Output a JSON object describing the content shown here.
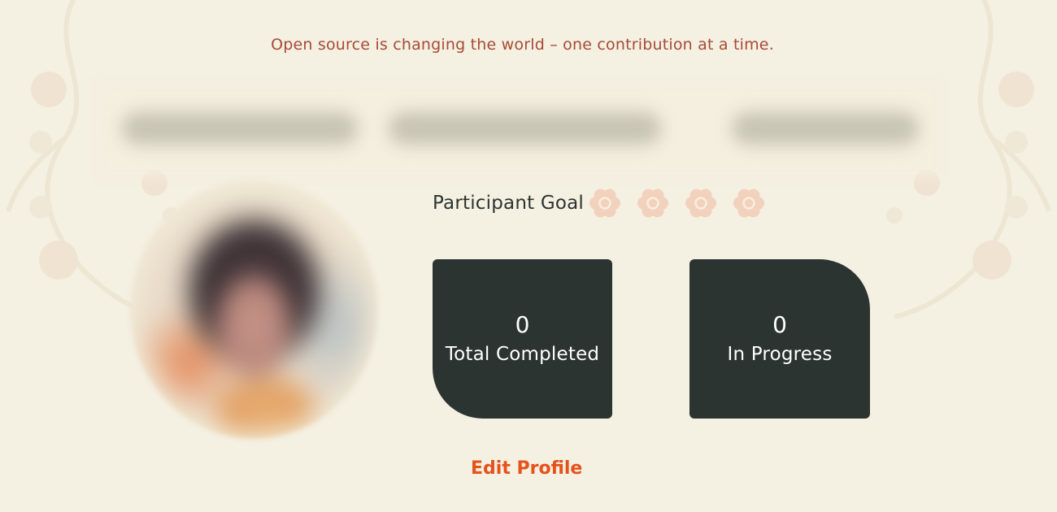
{
  "tagline": "Open source is changing the world – one contribution at a time.",
  "goal": {
    "label": "Participant Goal",
    "total": 4,
    "achieved": 0,
    "icon": "flower-badge-icon",
    "icon_color": "#f2d2bd"
  },
  "stats": {
    "completed": {
      "value": "0",
      "label": "Total Completed"
    },
    "in_progress": {
      "value": "0",
      "label": "In Progress"
    }
  },
  "actions": {
    "edit_profile": "Edit Profile"
  },
  "colors": {
    "background": "#f4f0e2",
    "card": "#2c3431",
    "accent": "#e5521b",
    "tagline": "#a84a36"
  }
}
